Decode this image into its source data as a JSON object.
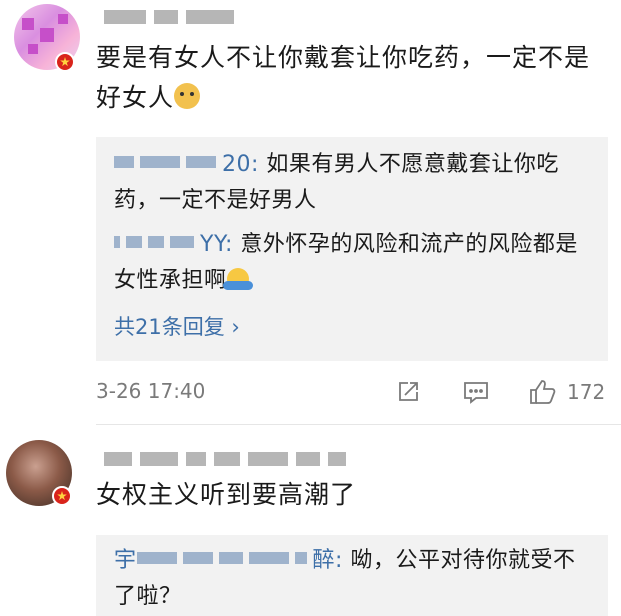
{
  "comments": [
    {
      "text": "要是有女人不让你戴套让你吃药，一定不是好女人",
      "emoji": "doge-emoji",
      "replies": [
        {
          "name_suffix": "20",
          "text": "如果有男人不愿意戴套让你吃药，一定不是好男人"
        },
        {
          "name_suffix": "YY",
          "text": "意外怀孕的风险和流产的风险都是女性承担啊",
          "emoji": "shrug-emoji"
        }
      ],
      "more_replies": "共21条回复 ›",
      "time": "3-26 17:40",
      "like_count": "172",
      "icons": [
        "share-icon",
        "comment-icon",
        "like-icon"
      ]
    },
    {
      "text": "女权主义听到要高潮了",
      "replies": [
        {
          "name_prefix": "宇",
          "name_suffix": "醉",
          "text": "呦，公平对待你就受不了啦？"
        }
      ]
    }
  ],
  "colors": {
    "link": "#3d6fa8",
    "reply_bg": "#f2f2f2",
    "meta": "#7a7a7a"
  }
}
